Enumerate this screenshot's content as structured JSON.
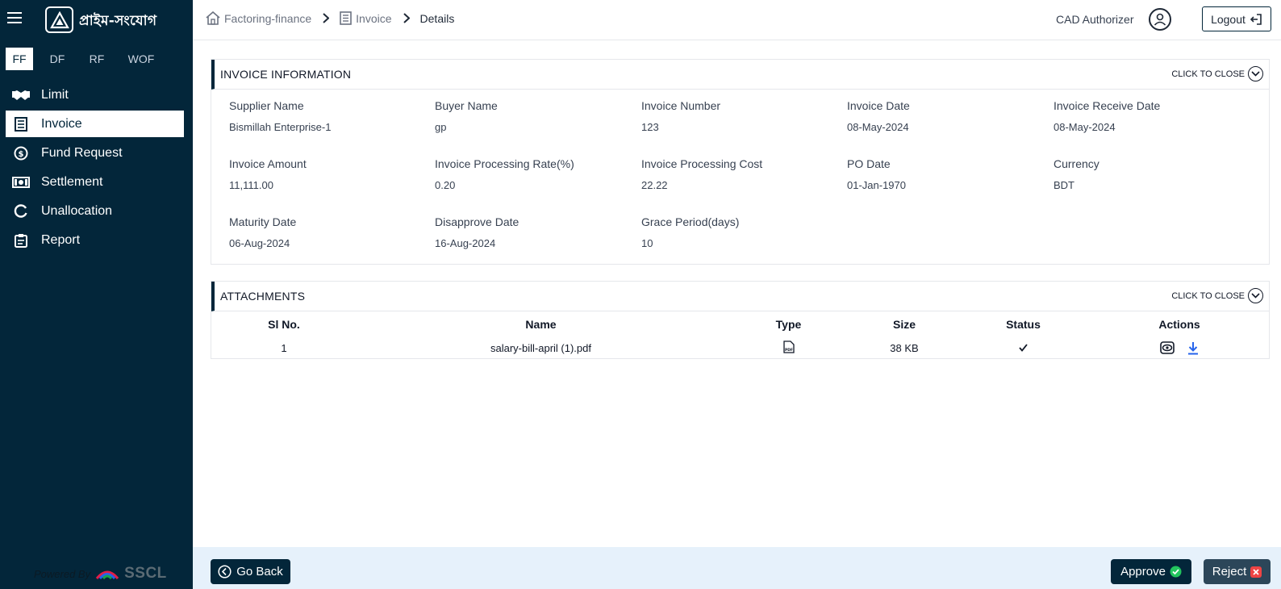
{
  "brand": {
    "name": "প্রাইম-সংযোগ"
  },
  "tabs": [
    {
      "label": "FF",
      "active": true
    },
    {
      "label": "DF",
      "active": false
    },
    {
      "label": "RF",
      "active": false
    },
    {
      "label": "WOF",
      "active": false
    }
  ],
  "nav": [
    {
      "label": "Limit",
      "icon": "handshake-icon"
    },
    {
      "label": "Invoice",
      "icon": "invoice-icon",
      "active": true
    },
    {
      "label": "Fund Request",
      "icon": "coin-icon"
    },
    {
      "label": "Settlement",
      "icon": "banknote-icon"
    },
    {
      "label": "Unallocation",
      "icon": "circle-icon"
    },
    {
      "label": "Report",
      "icon": "clipboard-icon"
    }
  ],
  "powered": {
    "label": "Powered By",
    "brand": "SSCL"
  },
  "breadcrumb": [
    {
      "label": "Factoring-finance",
      "icon": "home-icon"
    },
    {
      "label": "Invoice",
      "icon": "invoice-icon"
    },
    {
      "label": "Details"
    }
  ],
  "header": {
    "user": "CAD Authorizer",
    "logout": "Logout"
  },
  "invoice_info": {
    "title": "INVOICE INFORMATION",
    "toggle": "CLICK TO CLOSE",
    "fields": [
      {
        "label": "Supplier Name",
        "value": "Bismillah Enterprise-1"
      },
      {
        "label": "Buyer Name",
        "value": "gp"
      },
      {
        "label": "Invoice Number",
        "value": "123"
      },
      {
        "label": "Invoice Date",
        "value": "08-May-2024"
      },
      {
        "label": "Invoice Receive Date",
        "value": "08-May-2024"
      },
      {
        "label": "Invoice Amount",
        "value": "11,111.00"
      },
      {
        "label": "Invoice Processing Rate(%)",
        "value": "0.20"
      },
      {
        "label": "Invoice Processing Cost",
        "value": "22.22"
      },
      {
        "label": "PO Date",
        "value": "01-Jan-1970"
      },
      {
        "label": "Currency",
        "value": "BDT"
      },
      {
        "label": "Maturity Date",
        "value": "06-Aug-2024"
      },
      {
        "label": "Disapprove Date",
        "value": "16-Aug-2024"
      },
      {
        "label": "Grace Period(days)",
        "value": "10"
      }
    ]
  },
  "attachments": {
    "title": "ATTACHMENTS",
    "toggle": "CLICK TO CLOSE",
    "columns": [
      "Sl No.",
      "Name",
      "Type",
      "Size",
      "Status",
      "Actions"
    ],
    "rows": [
      {
        "sl": "1",
        "name": "salary-bill-april (1).pdf",
        "type": "pdf-icon",
        "size": "38 KB",
        "status": "check-icon"
      }
    ]
  },
  "footer": {
    "back": "Go Back",
    "approve": "Approve",
    "reject": "Reject"
  },
  "colors": {
    "sidebar": "#03263a",
    "footer": "#e6f1fb",
    "approve": "#22c55e",
    "reject": "#ef4444",
    "download": "#2563eb"
  }
}
